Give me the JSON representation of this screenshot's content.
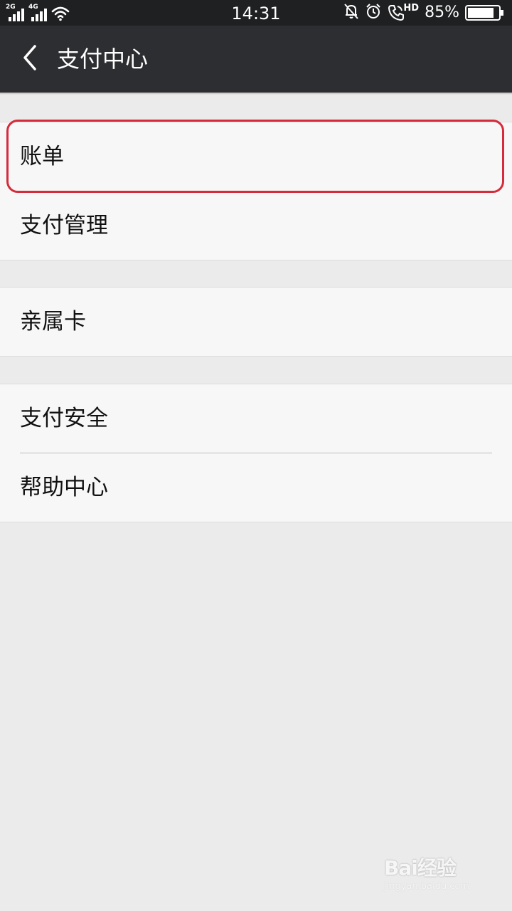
{
  "status_bar": {
    "sim1_network": "2G",
    "sim2_network": "4G",
    "time": "14:31",
    "hd_label": "HD",
    "battery_percent": "85%",
    "battery_level": 0.85,
    "icons": [
      "signal-icon",
      "wifi-icon",
      "mute-icon",
      "alarm-icon",
      "call-hd-icon",
      "battery-icon"
    ]
  },
  "header": {
    "back_icon": "chevron-left-icon",
    "title": "支付中心"
  },
  "groups": [
    {
      "items": [
        {
          "label": "账单"
        },
        {
          "label": "支付管理"
        }
      ]
    },
    {
      "items": [
        {
          "label": "亲属卡"
        }
      ]
    },
    {
      "items": [
        {
          "label": "支付安全"
        },
        {
          "label": "帮助中心"
        }
      ]
    }
  ],
  "highlight_color": "#d52b3a",
  "watermark": {
    "text": "Bai经验",
    "url": "jingyan.baidu.com"
  }
}
